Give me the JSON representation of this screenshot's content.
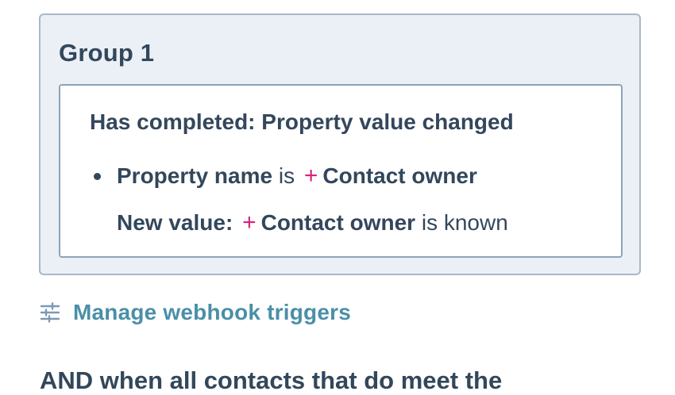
{
  "group": {
    "title": "Group 1",
    "criteria": {
      "heading": "Has completed: Property value changed",
      "line1": {
        "label": "Property name",
        "operator": "is",
        "plus": "+",
        "value": "Contact owner"
      },
      "line2": {
        "label": "New value:",
        "plus": "+",
        "value": "Contact owner",
        "operator": "is known"
      }
    }
  },
  "manage_link": {
    "label": "Manage webhook triggers",
    "icon": "sliders-icon"
  },
  "next_section": {
    "text": "AND when all contacts that do meet the"
  },
  "colors": {
    "card_bg": "#eaf0f6",
    "text": "#33475b",
    "link": "#4a8fa8",
    "plus": "#d6247a"
  }
}
